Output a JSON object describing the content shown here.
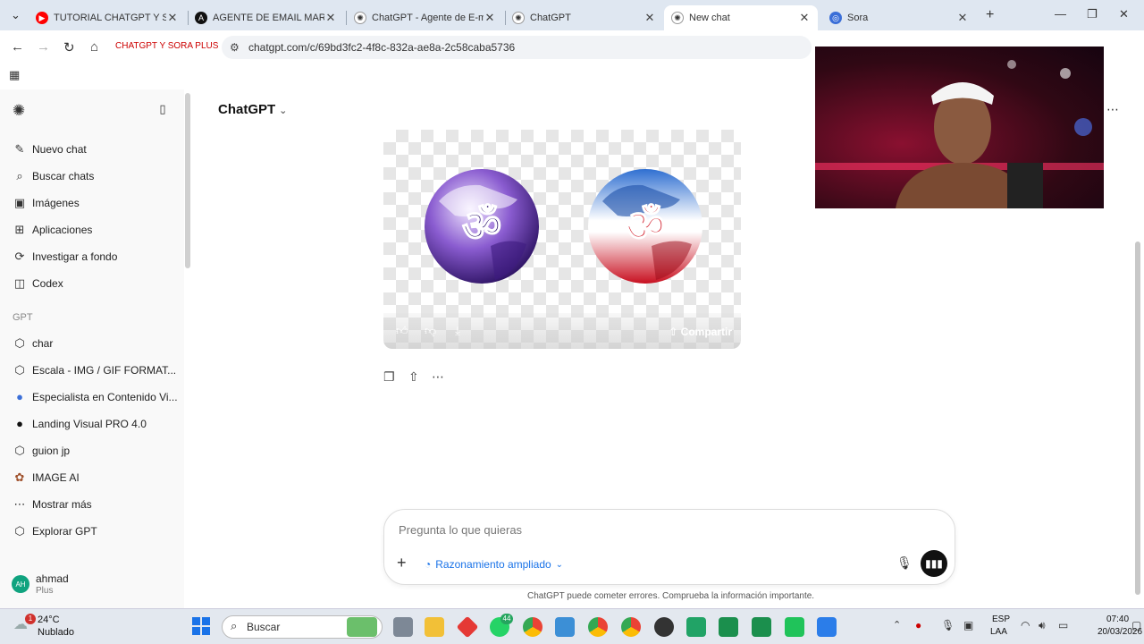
{
  "browser": {
    "tabs": [
      {
        "label": "TUTORIAL CHATGPT Y SOR",
        "color": "#ff0000",
        "glyph": "▶"
      },
      {
        "label": "AGENTE DE EMAIL MARKE",
        "color": "#111111",
        "glyph": "A"
      },
      {
        "label": "ChatGPT - Agente de E-ma",
        "color": "#333333",
        "glyph": "✺"
      },
      {
        "label": "ChatGPT",
        "color": "#333333",
        "glyph": "✺"
      },
      {
        "label": "New chat",
        "color": "#333333",
        "glyph": "✺"
      },
      {
        "label": "Sora",
        "color": "#3b6fd8",
        "glyph": "◎"
      }
    ],
    "bookmark": "CHATGPT Y SORA PLUS",
    "url": "chatgpt.com/c/69bd3fc2-4f8c-832a-ae8a-2c58caba5736"
  },
  "sidebar": {
    "items": [
      {
        "label": "Nuevo chat",
        "icon": "edit-icon"
      },
      {
        "label": "Buscar chats",
        "icon": "search-icon"
      },
      {
        "label": "Imágenes",
        "icon": "image-icon"
      },
      {
        "label": "Aplicaciones",
        "icon": "apps-icon"
      },
      {
        "label": "Investigar a fondo",
        "icon": "research-icon"
      },
      {
        "label": "Codex",
        "icon": "code-icon"
      }
    ],
    "section": "GPT",
    "gpts": [
      {
        "label": "char"
      },
      {
        "label": "Escala - IMG / GIF FORMAT..."
      },
      {
        "label": "Especialista en Contenido Vi..."
      },
      {
        "label": "Landing Visual PRO 4.0"
      },
      {
        "label": "guion jp"
      },
      {
        "label": "IMAGE AI"
      },
      {
        "label": "Mostrar más"
      },
      {
        "label": "Explorar GPT"
      }
    ],
    "user": {
      "initials": "AH",
      "name": "ahmad",
      "plan": "Plus"
    }
  },
  "main": {
    "header": "ChatGPT",
    "share_label": "Compartir",
    "composer_placeholder": "Pregunta lo que quieras",
    "reasoning_label": "Razonamiento ampliado",
    "disclaimer": "ChatGPT puede cometer errores. Comprueba la información importante."
  },
  "taskbar": {
    "weather_temp": "24°C",
    "weather_desc": "Nublado",
    "weather_badge": "1",
    "search_label": "Buscar",
    "lang1": "ESP",
    "lang2": "LAA",
    "time": "07:40",
    "date": "20/03/2026",
    "whatsapp_badge": "44"
  }
}
